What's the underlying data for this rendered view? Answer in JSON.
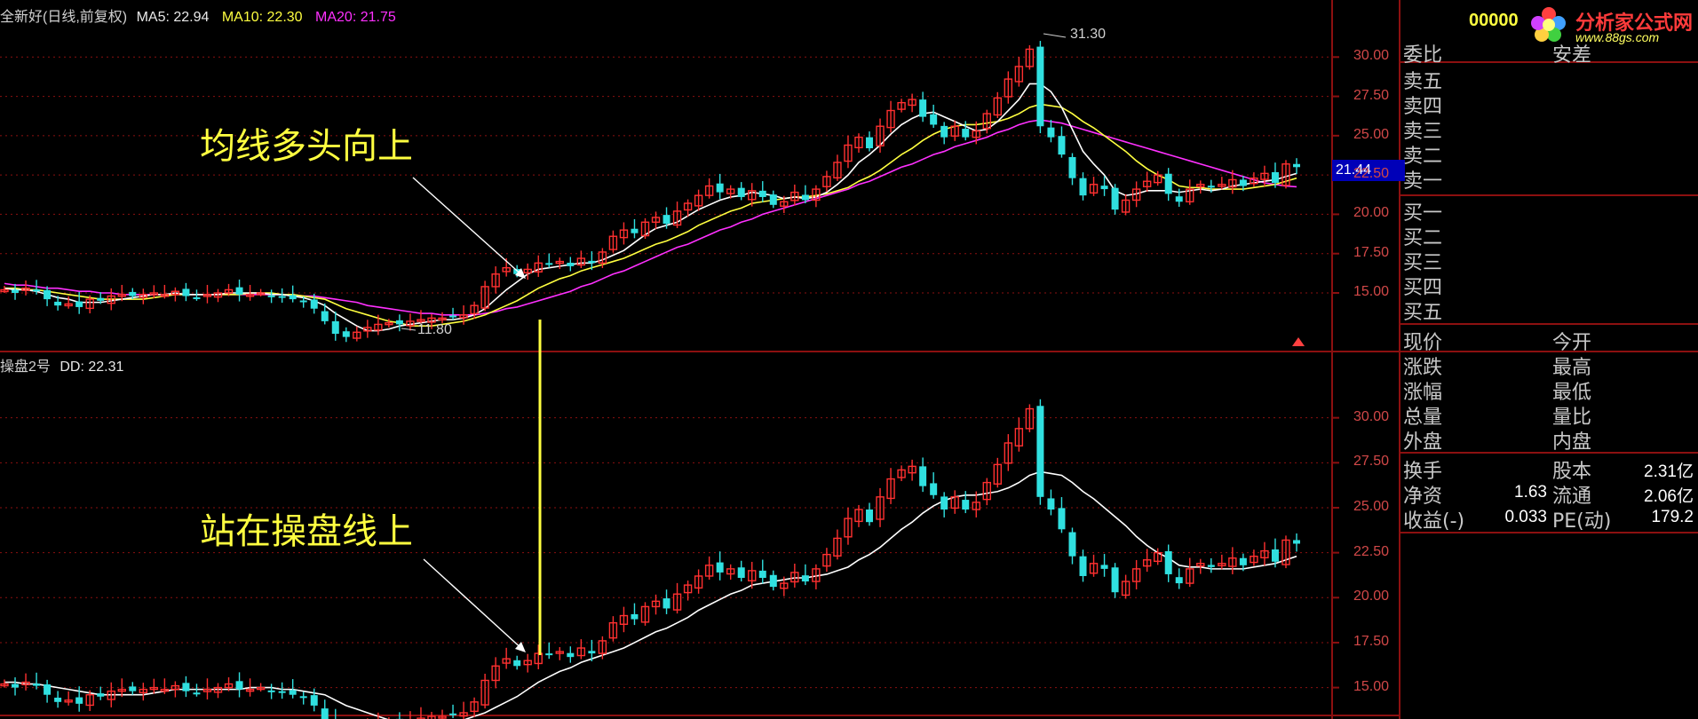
{
  "top_header": {
    "stock_name": "全新好(日线,前复权)",
    "ma5": "MA5: 22.94",
    "ma10": "MA10: 22.30",
    "ma20": "MA20: 21.75"
  },
  "bottom_header": {
    "indicator": "操盘2号",
    "dd": "DD: 22.31"
  },
  "annotations": {
    "top": "均线多头向上",
    "bottom": "站在操盘线上"
  },
  "chart_labels": {
    "high_label": "31.30",
    "low_label": "11.80",
    "current_price": "21.44"
  },
  "top_axis_ticks": [
    "30.00",
    "27.50",
    "25.00",
    "22.50",
    "20.00",
    "17.50",
    "15.00"
  ],
  "bottom_axis_ticks": [
    "30.00",
    "27.50",
    "25.00",
    "22.50",
    "20.00",
    "17.50",
    "15.00"
  ],
  "logo": {
    "code": "00000",
    "brand": "分析家公式网",
    "url": "www.88gs.com"
  },
  "side_panel": {
    "weibi": "委比",
    "weibi_val": "安差",
    "sell": [
      "卖五",
      "卖四",
      "卖三",
      "卖二",
      "卖一"
    ],
    "buy": [
      "买一",
      "买二",
      "买三",
      "买四",
      "买五"
    ],
    "quote_rows": [
      {
        "left": "现价",
        "right": "今开"
      },
      {
        "left": "涨跌",
        "right": "最高"
      },
      {
        "left": "涨幅",
        "right": "最低"
      },
      {
        "left": "总量",
        "right": "量比"
      },
      {
        "left": "外盘",
        "right": "内盘"
      }
    ],
    "fund_rows": [
      {
        "left": "换手",
        "left_val": "",
        "right": "股本",
        "right_val": "2.31亿"
      },
      {
        "left": "净资",
        "left_val": "1.63",
        "right": "流通",
        "right_val": "2.06亿"
      },
      {
        "left": "收益(-)",
        "left_val": "0.033",
        "right": "PE(动)",
        "right_val": "179.2"
      }
    ]
  },
  "colors": {
    "up": "#ff3030",
    "down": "#30e0e0",
    "ma5": "#ffffff",
    "ma10": "#ffff40",
    "ma20": "#ff30ff",
    "grid": "#8c1010",
    "annotation": "#ffff40"
  },
  "chart_data": [
    {
      "type": "candlestick",
      "title": "",
      "ylim": [
        11.5,
        32.5
      ],
      "yticks": [
        15,
        17.5,
        20,
        22.5,
        25,
        27.5,
        30
      ],
      "closes": [
        15.2,
        15.0,
        15.3,
        15.1,
        14.6,
        14.2,
        14.3,
        14.1,
        14.6,
        14.5,
        14.8,
        14.9,
        14.8,
        14.9,
        15.0,
        14.9,
        15.1,
        14.8,
        14.7,
        14.9,
        15.0,
        15.2,
        14.9,
        14.9,
        15.0,
        14.8,
        14.7,
        14.6,
        14.5,
        14.0,
        13.2,
        12.4,
        12.2,
        12.5,
        12.8,
        13.0,
        13.1,
        13.0,
        13.2,
        13.3,
        13.4,
        13.4,
        13.5,
        13.6,
        14.2,
        15.4,
        16.2,
        16.6,
        16.2,
        16.5,
        16.9,
        16.8,
        17.0,
        16.7,
        17.2,
        16.9,
        17.6,
        18.6,
        19.0,
        18.8,
        19.5,
        19.8,
        19.4,
        20.2,
        20.7,
        21.2,
        21.8,
        21.4,
        21.6,
        21.1,
        21.5,
        21.1,
        20.6,
        20.8,
        21.4,
        20.9,
        21.6,
        22.4,
        23.3,
        24.4,
        24.9,
        24.2,
        25.6,
        26.6,
        27.1,
        27.3,
        26.2,
        25.7,
        24.9,
        25.6,
        24.9,
        25.3,
        26.4,
        27.4,
        28.6,
        29.4,
        30.5,
        25.6,
        24.9,
        23.8,
        22.3,
        21.2,
        21.9,
        21.6,
        20.3,
        20.9,
        21.6,
        22.1,
        22.5,
        21.3,
        20.8,
        21.6,
        21.9,
        21.7,
        21.9,
        22.2,
        21.8,
        22.3,
        22.6,
        22.0,
        23.2,
        23.0
      ],
      "ma5": [
        15.3,
        15.2,
        15.2,
        15.1,
        14.9,
        14.7,
        14.6,
        14.4,
        14.4,
        14.4,
        14.5,
        14.6,
        14.7,
        14.8,
        14.9,
        14.9,
        15.0,
        14.9,
        14.9,
        14.9,
        14.9,
        15.0,
        15.0,
        15.0,
        15.0,
        14.9,
        14.9,
        14.8,
        14.7,
        14.5,
        14.2,
        13.7,
        13.3,
        12.9,
        12.6,
        12.6,
        12.7,
        12.9,
        13.0,
        13.1,
        13.2,
        13.3,
        13.3,
        13.4,
        13.6,
        14.0,
        14.6,
        15.2,
        15.7,
        16.2,
        16.5,
        16.6,
        16.7,
        16.8,
        16.9,
        16.9,
        17.1,
        17.4,
        17.7,
        18.2,
        18.7,
        19.1,
        19.3,
        19.5,
        19.9,
        20.3,
        20.6,
        20.9,
        21.1,
        21.2,
        21.4,
        21.3,
        21.2,
        21.0,
        21.1,
        21.0,
        21.1,
        21.4,
        21.9,
        22.5,
        23.3,
        23.8,
        24.4,
        25.1,
        25.7,
        26.1,
        26.4,
        26.5,
        26.2,
        25.9,
        25.6,
        25.3,
        25.4,
        25.9,
        26.6,
        27.3,
        28.3,
        28.3,
        27.8,
        26.8,
        25.4,
        24.0,
        23.2,
        22.5,
        21.5,
        21.2,
        21.3,
        21.5,
        21.5,
        21.5,
        21.4,
        21.5,
        21.6,
        21.5,
        21.6,
        21.8,
        21.9,
        22.0,
        22.1,
        22.2,
        22.4,
        22.6
      ],
      "ma10": [
        15.3,
        15.3,
        15.2,
        15.2,
        15.1,
        15.0,
        14.9,
        14.8,
        14.7,
        14.6,
        14.6,
        14.6,
        14.6,
        14.6,
        14.7,
        14.8,
        14.9,
        14.9,
        14.9,
        14.9,
        14.9,
        14.9,
        14.9,
        15.0,
        15.0,
        15.0,
        14.9,
        14.9,
        14.8,
        14.7,
        14.6,
        14.3,
        14.0,
        13.8,
        13.6,
        13.4,
        13.2,
        13.1,
        12.9,
        12.9,
        12.9,
        13.0,
        13.1,
        13.2,
        13.4,
        13.6,
        13.9,
        14.2,
        14.5,
        14.9,
        15.3,
        15.6,
        15.9,
        16.1,
        16.4,
        16.6,
        16.8,
        17.0,
        17.2,
        17.5,
        17.8,
        18.1,
        18.3,
        18.6,
        18.9,
        19.3,
        19.6,
        19.9,
        20.2,
        20.4,
        20.7,
        20.8,
        20.9,
        21.0,
        21.1,
        21.1,
        21.2,
        21.3,
        21.5,
        21.7,
        22.1,
        22.4,
        22.8,
        23.3,
        23.8,
        24.2,
        24.7,
        25.1,
        25.4,
        25.6,
        25.7,
        25.7,
        25.8,
        25.9,
        26.1,
        26.4,
        26.8,
        27.0,
        26.9,
        26.8,
        26.4,
        25.9,
        25.5,
        25.0,
        24.5,
        24.0,
        23.4,
        22.9,
        22.5,
        22.2,
        21.8,
        21.7,
        21.7,
        21.6,
        21.6,
        21.6,
        21.6,
        21.7,
        21.8,
        21.9,
        22.1,
        22.3
      ],
      "ma20": [
        15.6,
        15.5,
        15.5,
        15.4,
        15.3,
        15.3,
        15.2,
        15.1,
        15.1,
        15.0,
        15.0,
        14.9,
        14.9,
        14.9,
        14.9,
        14.9,
        14.9,
        14.9,
        14.9,
        14.9,
        14.9,
        14.9,
        14.9,
        14.9,
        14.9,
        14.9,
        14.9,
        14.9,
        14.8,
        14.8,
        14.7,
        14.6,
        14.5,
        14.4,
        14.2,
        14.1,
        14.0,
        13.9,
        13.8,
        13.7,
        13.7,
        13.6,
        13.6,
        13.6,
        13.6,
        13.7,
        13.8,
        14.0,
        14.1,
        14.3,
        14.5,
        14.7,
        14.9,
        15.1,
        15.4,
        15.6,
        15.9,
        16.2,
        16.4,
        16.7,
        17.0,
        17.3,
        17.6,
        17.9,
        18.1,
        18.4,
        18.7,
        19.0,
        19.2,
        19.5,
        19.7,
        20.0,
        20.2,
        20.4,
        20.6,
        20.8,
        21.0,
        21.2,
        21.4,
        21.6,
        21.9,
        22.1,
        22.4,
        22.7,
        23.0,
        23.2,
        23.5,
        23.8,
        24.0,
        24.3,
        24.5,
        24.7,
        24.9,
        25.2,
        25.4,
        25.7,
        25.9,
        26.0,
        25.9,
        25.8,
        25.6,
        25.4,
        25.2,
        25.0,
        24.8,
        24.6,
        24.4,
        24.2,
        24.0,
        23.8,
        23.6,
        23.4,
        23.2,
        23.0,
        22.8,
        22.6,
        22.4,
        22.2,
        22.0,
        21.9,
        21.8,
        21.75
      ]
    },
    {
      "type": "candlestick",
      "title": "",
      "ylim": [
        13.5,
        32.5
      ],
      "yticks": [
        15,
        17.5,
        20,
        22.5,
        25,
        27.5,
        30
      ],
      "series": [
        {
          "name": "DD",
          "last": 22.31
        }
      ]
    }
  ]
}
